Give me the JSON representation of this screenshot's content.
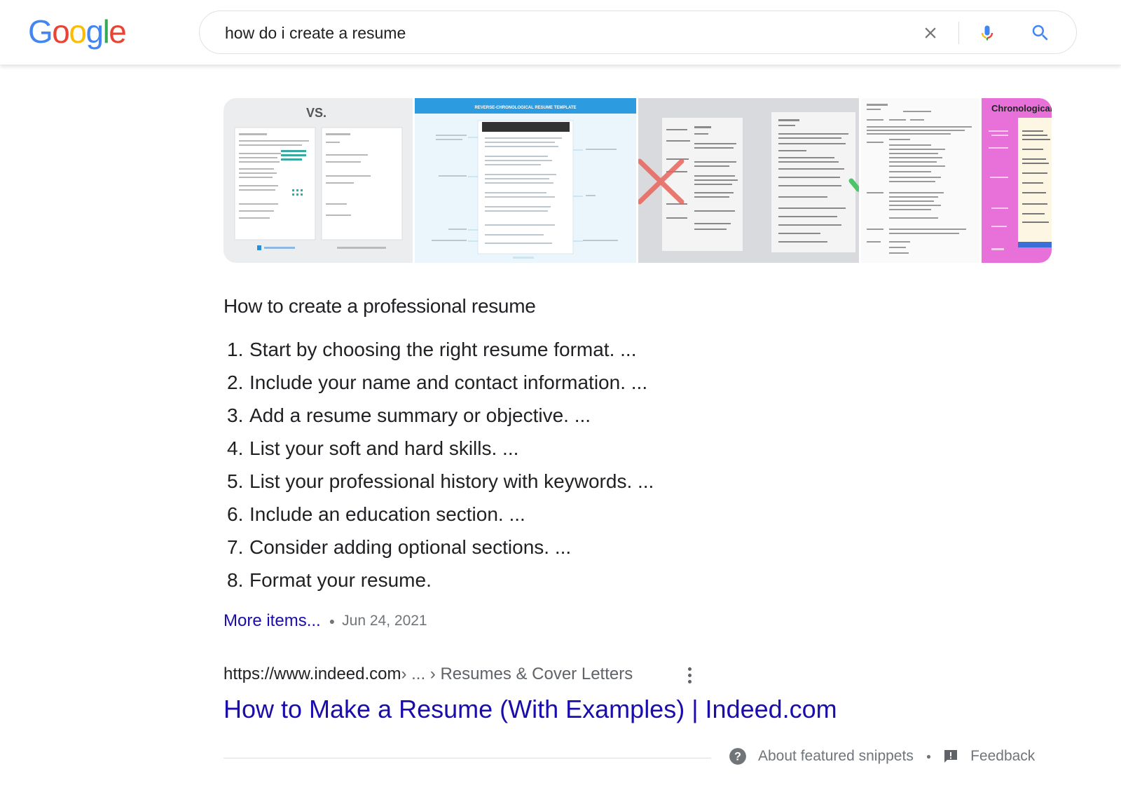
{
  "header": {
    "logo_letters": [
      {
        "ch": "G",
        "color": "#4285F4"
      },
      {
        "ch": "o",
        "color": "#EA4335"
      },
      {
        "ch": "o",
        "color": "#FBBC05"
      },
      {
        "ch": "g",
        "color": "#4285F4"
      },
      {
        "ch": "l",
        "color": "#34A853"
      },
      {
        "ch": "e",
        "color": "#EA4335"
      }
    ],
    "search": {
      "value": "how do i create a resume",
      "clear_icon": "close-icon",
      "voice_icon": "microphone-icon",
      "search_icon": "search-icon"
    }
  },
  "images": {
    "thumb_2_heading": "REVERSE-CHRONOLOGICAL RESUME TEMPLATE",
    "thumb_5_heading": "Chronological"
  },
  "snippet": {
    "title": "How to create a professional resume",
    "steps": [
      {
        "num": "1.",
        "text": "Start by choosing the right resume format. ..."
      },
      {
        "num": "2.",
        "text": "Include your name and contact information. ..."
      },
      {
        "num": "3.",
        "text": "Add a resume summary or objective. ..."
      },
      {
        "num": "4.",
        "text": "List your soft and hard skills. ..."
      },
      {
        "num": "5.",
        "text": "List your professional history with keywords. ..."
      },
      {
        "num": "6.",
        "text": "Include an education section. ..."
      },
      {
        "num": "7.",
        "text": "Consider adding optional sections. ..."
      },
      {
        "num": "8.",
        "text": "Format your resume."
      }
    ],
    "more_items": "More items...",
    "date": "Jun 24, 2021"
  },
  "result": {
    "url": "https://www.indeed.com",
    "breadcrumb": " › ... › Resumes & Cover Letters",
    "title": "How to Make a Resume (With Examples) | Indeed.com"
  },
  "footer": {
    "about": "About featured snippets",
    "feedback": "Feedback"
  },
  "colors": {
    "link_blue": "#1a0dab",
    "meta_gray": "#70757a"
  }
}
